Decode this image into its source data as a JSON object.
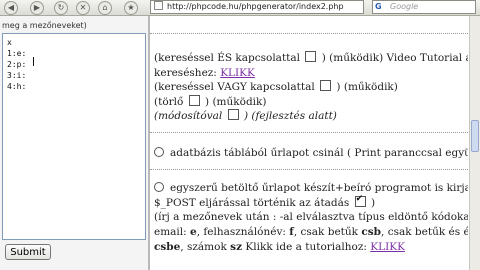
{
  "toolbar": {
    "url": "http://phpcode.hu/phpgenerator/index2.php",
    "search_placeholder": "Google",
    "search_engine_glyph": "G"
  },
  "left": {
    "header": "meg a mezőneveket)",
    "textarea_lines": [
      "x",
      "1:e:",
      "2:p:",
      "3:i:",
      "4:h:"
    ],
    "submit_label": "Submit"
  },
  "right": {
    "line1_a": "(kereséssel ÉS kapcsolattal",
    "line1_b": ") (működik) Video Tutorial a",
    "line2_a": "kereséshez:",
    "line2_link": "KLIKK",
    "line3_a": "(kereséssel VAGY kapcsolattal",
    "line3_b": ") (működik)",
    "line4_a": "(törlő",
    "line4_b": ") (működik)",
    "line5_a": "(módosítóval",
    "line5_b": ") (fejlesztés alatt)",
    "opt_db_a": "adatbázis táblából űrlapot csinál ( Print paranccsal együtt",
    "opt_db_b": ")",
    "opt_form_a": "egyszerű betöltő űrlapot készít+beíró programot is kirja (",
    "line8_a": "$_POST eljárással történik az átadás",
    "line8_b": ")",
    "line9": "(írj a mezőnevek után : -al elválasztva típus eldöntő kódokat:",
    "line10_a": "email:",
    "line10_b": "e",
    "line10_c": ", felhasználónév:",
    "line10_d": "f",
    "line10_e": ", csak betűk",
    "line10_f": "csb",
    "line10_g": ", csak betűk és ékezetek",
    "line11_a": "csbe",
    "line11_b": ", számok",
    "line11_c": "sz",
    "line11_d": "Klikk ide a tutorialhoz:",
    "line11_link": "KLIKK"
  }
}
